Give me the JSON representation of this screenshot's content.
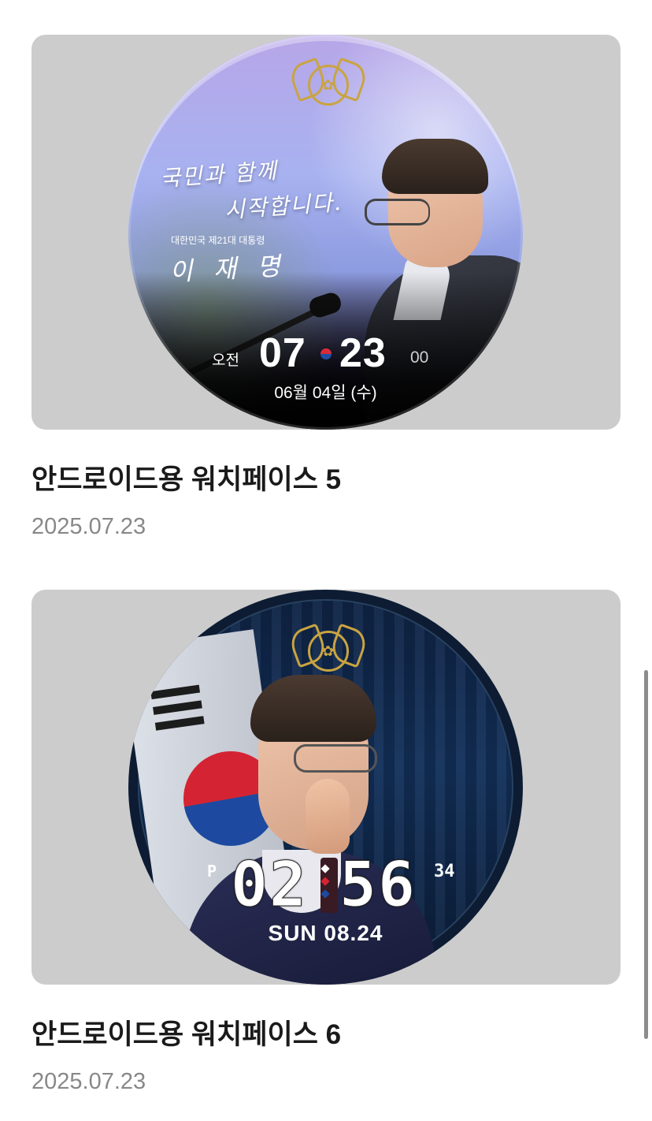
{
  "items": [
    {
      "title": "안드로이드용 워치페이스 5",
      "date": "2025.07.23",
      "watch_face": {
        "slogan_line1": "국민과 함께",
        "slogan_line2": "시작합니다.",
        "subtitle": "대한민국 제21대 대통령",
        "name": "이 재 명",
        "ampm": "오전",
        "hour": "07",
        "minute": "23",
        "second": "00",
        "date": "06월 04일 (수)"
      }
    },
    {
      "title": "안드로이드용 워치페이스 6",
      "date": "2025.07.23",
      "watch_face": {
        "ampm": "P",
        "hour": "02",
        "minute": "56",
        "second": "34",
        "date": "SUN 08.24"
      }
    }
  ],
  "colors": {
    "thumbnail_bg": "#cccccc",
    "title": "#1a1a1a",
    "date": "#888888",
    "emblem_gold": "#c9a441",
    "korea_red": "#d42433",
    "korea_blue": "#1d4aa0"
  }
}
